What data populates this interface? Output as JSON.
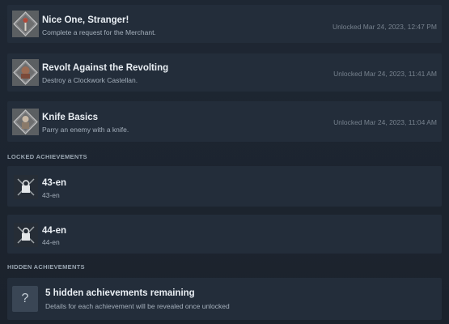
{
  "unlocked": [
    {
      "title": "Nice One, Stranger!",
      "description": "Complete a request for the Merchant.",
      "unlocked": "Unlocked Mar 24, 2023, 12:47 PM"
    },
    {
      "title": "Revolt Against the Revolting",
      "description": "Destroy a Clockwork Castellan.",
      "unlocked": "Unlocked Mar 24, 2023, 11:41 AM"
    },
    {
      "title": "Knife Basics",
      "description": "Parry an enemy with a knife.",
      "unlocked": "Unlocked Mar 24, 2023, 11:04 AM"
    }
  ],
  "locked_header": "LOCKED ACHIEVEMENTS",
  "locked": [
    {
      "title": "43-en",
      "description": "43-en"
    },
    {
      "title": "44-en",
      "description": "44-en"
    }
  ],
  "hidden_header": "HIDDEN ACHIEVEMENTS",
  "hidden": {
    "icon": "?",
    "title": "5 hidden achievements remaining",
    "description": "Details for each achievement will be revealed once unlocked"
  }
}
